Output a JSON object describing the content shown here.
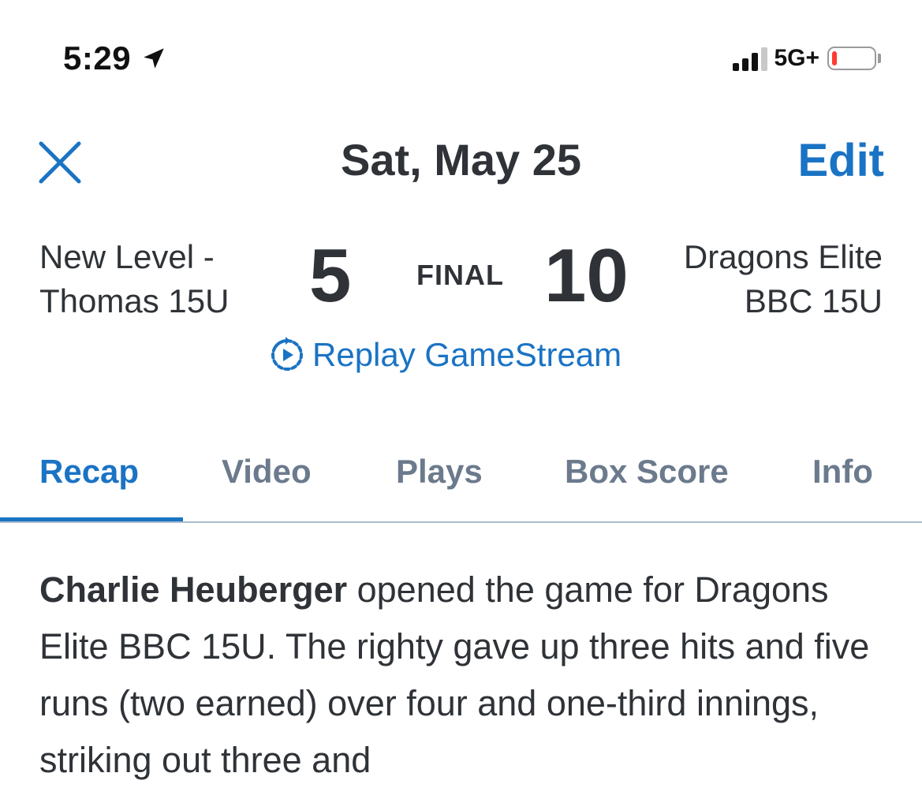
{
  "status_bar": {
    "time": "5:29",
    "network": "5G+",
    "signal_bars": 3,
    "signal_bars_total": 4,
    "battery_level": 0.1,
    "battery_color": "#ff3b30",
    "icons": [
      "location-arrow-icon",
      "signal-icon",
      "battery-icon"
    ]
  },
  "header": {
    "date": "Sat, May 25",
    "edit_label": "Edit",
    "close_icon": "close-icon"
  },
  "game": {
    "home_team_line1": "New Level -",
    "home_team_line2": "Thomas 15U",
    "home_score": "5",
    "status": "FINAL",
    "away_score": "10",
    "away_team_line1": "Dragons Elite",
    "away_team_line2": "BBC 15U",
    "replay_label": "Replay GameStream",
    "replay_icon": "replay-icon"
  },
  "tabs": [
    {
      "label": "Recap",
      "active": true
    },
    {
      "label": "Video",
      "active": false
    },
    {
      "label": "Plays",
      "active": false
    },
    {
      "label": "Box Score",
      "active": false
    },
    {
      "label": "Info",
      "active": false
    }
  ],
  "recap": {
    "player_name": "Charlie Heuberger",
    "text": " opened the game for Dragons Elite BBC 15U. The righty gave up three hits and five runs (two earned) over four and one-third innings, striking out three and"
  },
  "colors": {
    "accent": "#1a73c4",
    "text": "#2f3338",
    "tab_inactive": "#6b7a8c"
  }
}
